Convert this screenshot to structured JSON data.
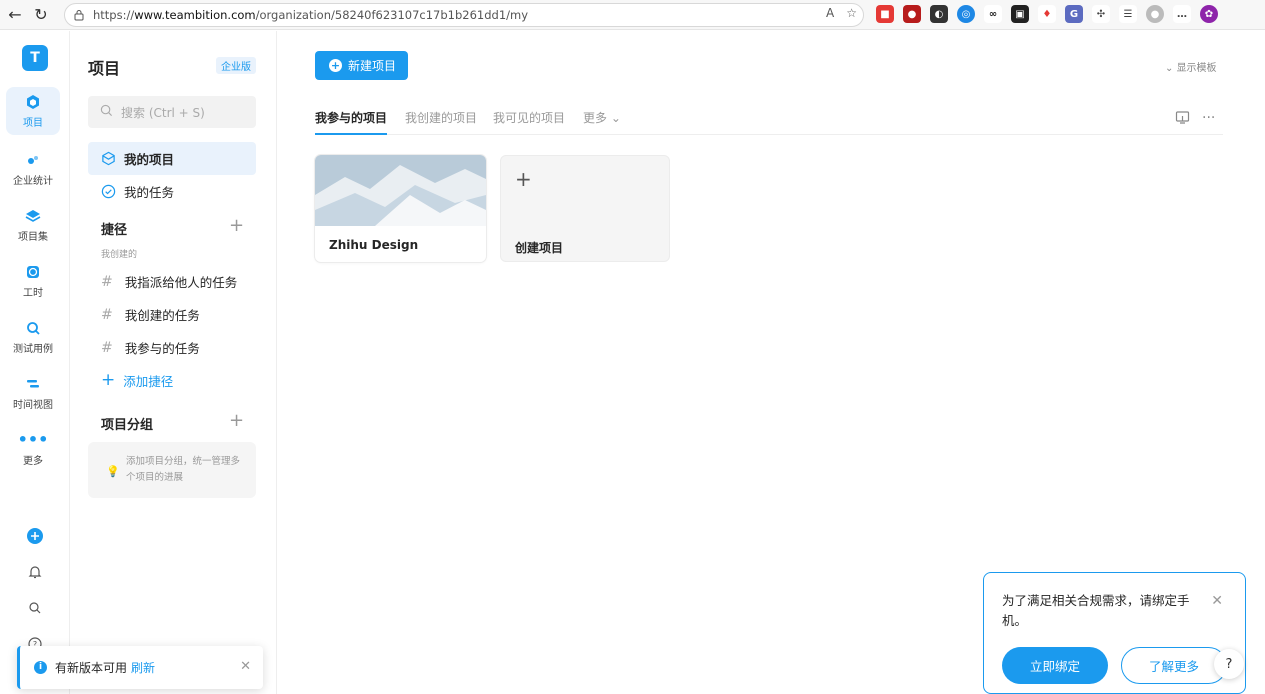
{
  "browser": {
    "url_prefix": "https://",
    "url_host": "www.teambition.com",
    "url_path": "/organization/58240f623107c17b1b261dd1/my"
  },
  "rail": {
    "logo": "T",
    "items": [
      {
        "label": "项目",
        "icon": "project-icon"
      },
      {
        "label": "企业统计",
        "icon": "stats-icon"
      },
      {
        "label": "项目集",
        "icon": "layers-icon"
      },
      {
        "label": "工时",
        "icon": "clock-icon"
      },
      {
        "label": "测试用例",
        "icon": "testcase-icon"
      },
      {
        "label": "时间视图",
        "icon": "timeline-icon"
      },
      {
        "label": "更多",
        "icon": "more-dots-icon"
      }
    ]
  },
  "sidebar": {
    "title": "项目",
    "badge": "企业版",
    "search_placeholder": "搜索 (Ctrl + S)",
    "my_projects": "我的项目",
    "my_tasks": "我的任务",
    "shortcuts_title": "捷径",
    "shortcuts_sub": "我创建的",
    "shortcuts": [
      "我指派给他人的任务",
      "我创建的任务",
      "我参与的任务"
    ],
    "add_shortcut": "添加捷径",
    "groups_title": "项目分组",
    "groups_tip": "添加项目分组，统一管理多个项目的进展"
  },
  "main": {
    "new_project": "新建项目",
    "show_template": "显示模板",
    "tabs": [
      "我参与的项目",
      "我创建的项目",
      "我可见的项目",
      "更多"
    ],
    "active_tab": "我参与的项目",
    "projects": [
      {
        "name": "Zhihu Design"
      }
    ],
    "create_project": "创建项目"
  },
  "toast": {
    "message": "有新版本可用",
    "action": "刷新"
  },
  "popup": {
    "message": "为了满足相关合规需求，请绑定手机。",
    "bind": "立即绑定",
    "learn_more": "了解更多"
  },
  "colors": {
    "accent": "#1b9aee"
  }
}
